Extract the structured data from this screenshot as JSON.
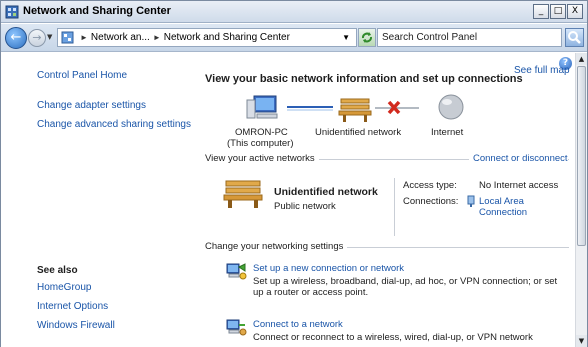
{
  "window": {
    "title": "Network and Sharing Center"
  },
  "window_buttons": {
    "minimize": "_",
    "maximize": "□",
    "close": "X"
  },
  "address": {
    "crumb1": "Network an...",
    "crumb2": "Network and Sharing Center",
    "search_placeholder": "Search Control Panel"
  },
  "sidebar": {
    "home": "Control Panel Home",
    "links": [
      "Change adapter settings",
      "Change advanced sharing settings"
    ],
    "see_also_title": "See also",
    "see_also": [
      "HomeGroup",
      "Internet Options",
      "Windows Firewall"
    ]
  },
  "main": {
    "heading": "View your basic network information and set up connections",
    "see_full_map": "See full map",
    "map": {
      "computer": "OMRON-PC",
      "computer_sub": "(This computer)",
      "network": "Unidentified network",
      "internet": "Internet"
    },
    "active": {
      "title": "View your active networks",
      "connect_link": "Connect or disconnect",
      "network_name": "Unidentified network",
      "network_type": "Public network",
      "access_label": "Access type:",
      "access_value": "No Internet access",
      "connections_label": "Connections:",
      "connections_value_1": "Local Area",
      "connections_value_2": "Connection"
    },
    "change": {
      "title": "Change your networking settings",
      "items": [
        {
          "title": "Set up a new connection or network",
          "desc": "Set up a wireless, broadband, dial-up, ad hoc, or VPN connection; or set up a router or access point."
        },
        {
          "title": "Connect to a network",
          "desc": "Connect or reconnect to a wireless, wired, dial-up, or VPN network"
        }
      ]
    }
  },
  "colors": {
    "link": "#1a55a8",
    "text": "#1e1e1e",
    "error_x": "#d22a1e"
  }
}
